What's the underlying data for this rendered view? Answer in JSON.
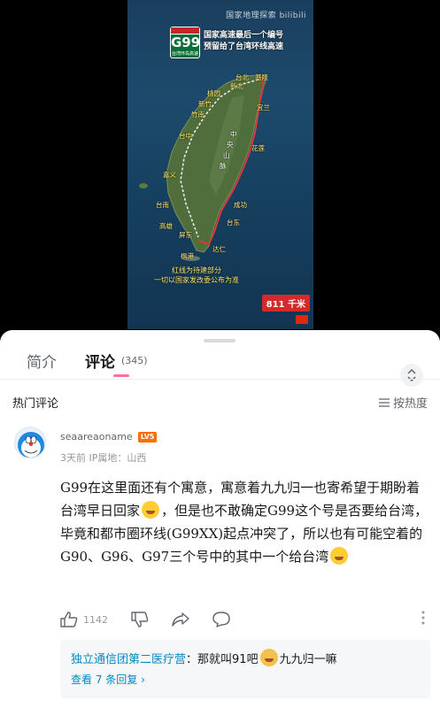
{
  "video": {
    "watermark": "国家地理探索",
    "watermark_brand": "bilibili",
    "sign_number": "G99",
    "sign_subtitle": "台湾环岛高速",
    "caption_top_line1": "国家高速最后一个编号",
    "caption_top_line2": "预留给了台湾环线高速",
    "places": {
      "taibei": "台北",
      "jilong": "基隆",
      "xinbei": "新北",
      "taoyuan": "桃园",
      "xinzhu": "新竹",
      "zhunan": "竹南",
      "yilan": "宜兰",
      "taizhong": "台中",
      "zhongyang1": "中",
      "zhongyang2": "央",
      "shanmai1": "山",
      "shanmai2": "脉",
      "hualian": "花莲",
      "jiayi": "嘉义",
      "tainan": "台南",
      "gaoxiong": "高雄",
      "pingdong": "屏东",
      "taidong": "台东",
      "chenggong": "成功",
      "daren": "达仁",
      "fengang": "枫港"
    },
    "caption_bottom_line1": "红线为待建部分",
    "caption_bottom_line2": "一切以国家发改委公布为准",
    "distance": "811 千米"
  },
  "tabs": {
    "intro": "简介",
    "comments": "评论",
    "comment_count": "(345)"
  },
  "hot_comments_title": "热门评论",
  "sort_label": "按热度",
  "comment": {
    "username": "seaareaoname",
    "level": "LV5",
    "meta": "3天前 IP属地：山西",
    "text_part1": "G99在这里面还有个寓意，寓意着九九归一也寄希望于期盼着台湾早日回家",
    "text_part2": "，但是也不敢确定G99这个号是否要给台湾，毕竟和都市圈环线(G99XX)起点冲突了，所以也有可能空着的G90、G96、G97三个号中的其中一个给台湾",
    "like_count": "1142"
  },
  "reply": {
    "user": "独立通信团第二医疗营",
    "sep": "：",
    "text_part1": "那就叫91吧",
    "text_part2": "九九归一嘛",
    "more": "查看 7 条回复 ›"
  },
  "colors": {
    "accent_pink": "#fb7299",
    "link_blue": "#008ac5",
    "level_orange": "#ff6c00"
  }
}
